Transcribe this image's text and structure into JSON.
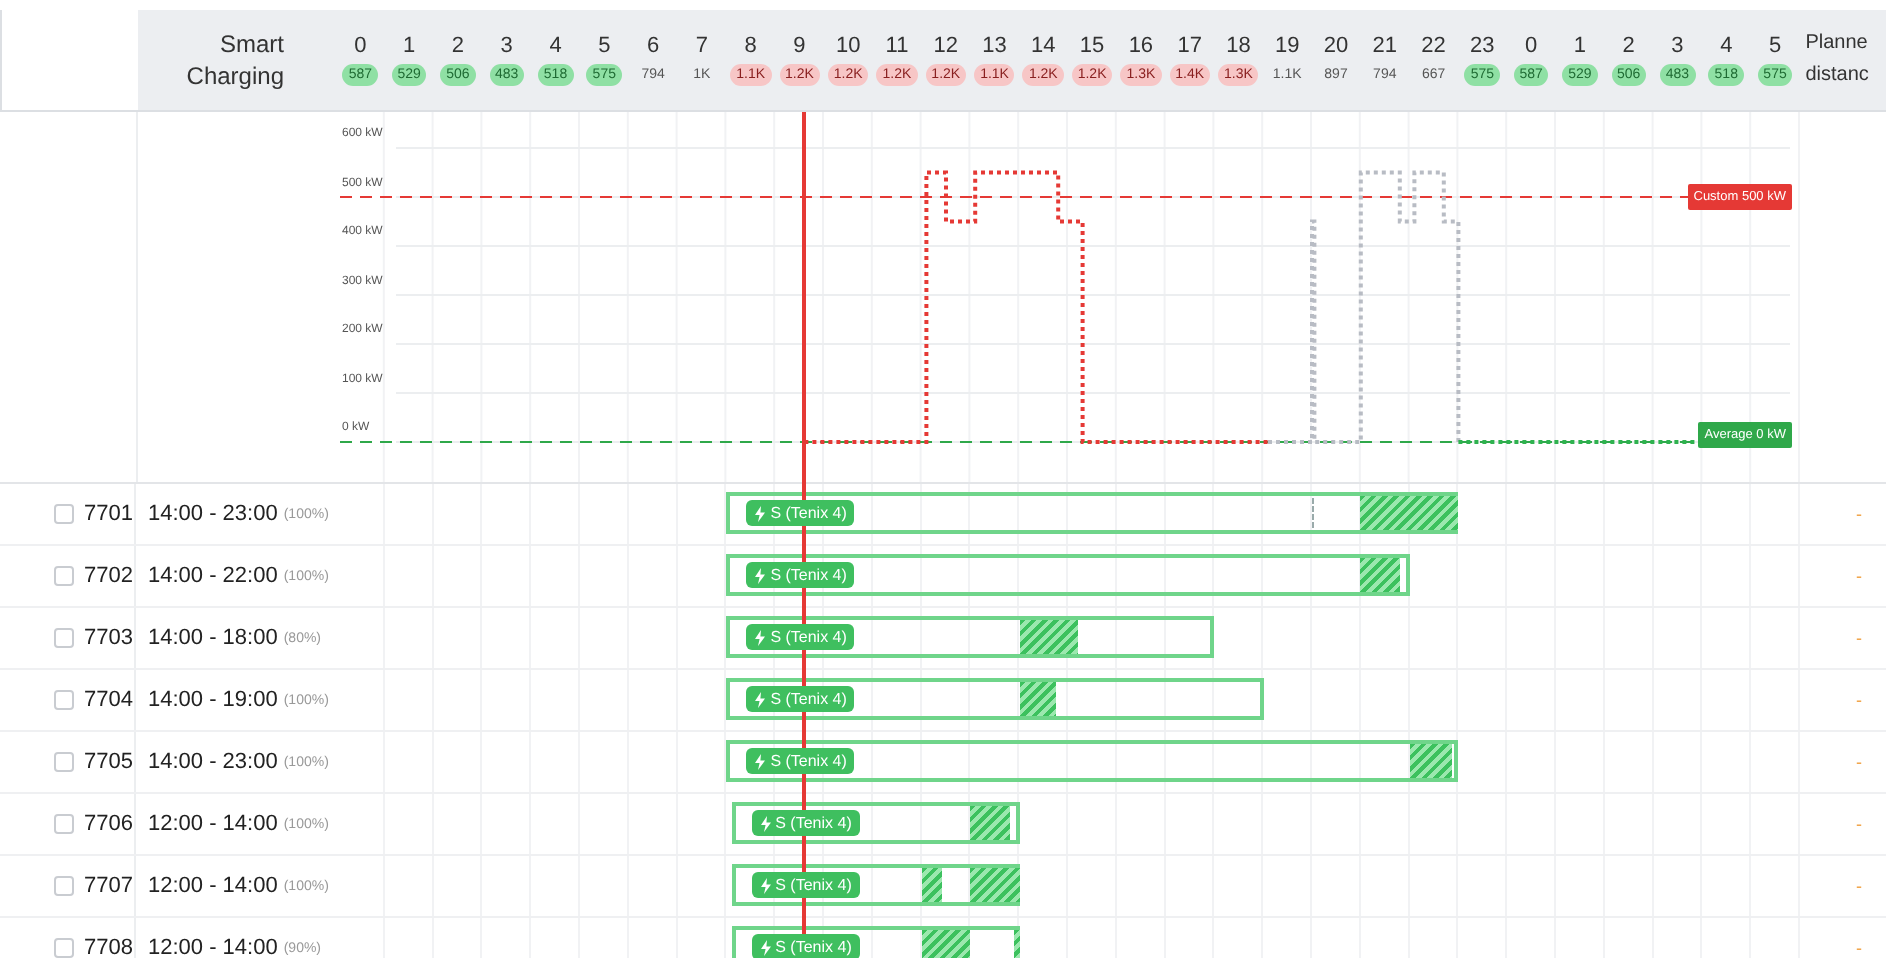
{
  "header": {
    "label_lines": [
      "Smart",
      "Charging"
    ],
    "hours": [
      {
        "hour": "0",
        "value": "587",
        "kind": "low"
      },
      {
        "hour": "1",
        "value": "529",
        "kind": "low"
      },
      {
        "hour": "2",
        "value": "506",
        "kind": "low"
      },
      {
        "hour": "3",
        "value": "483",
        "kind": "low"
      },
      {
        "hour": "4",
        "value": "518",
        "kind": "low"
      },
      {
        "hour": "5",
        "value": "575",
        "kind": "low"
      },
      {
        "hour": "6",
        "value": "794",
        "kind": "mid"
      },
      {
        "hour": "7",
        "value": "1K",
        "kind": "mid"
      },
      {
        "hour": "8",
        "value": "1.1K",
        "kind": "high"
      },
      {
        "hour": "9",
        "value": "1.2K",
        "kind": "high"
      },
      {
        "hour": "10",
        "value": "1.2K",
        "kind": "high"
      },
      {
        "hour": "11",
        "value": "1.2K",
        "kind": "high"
      },
      {
        "hour": "12",
        "value": "1.2K",
        "kind": "high"
      },
      {
        "hour": "13",
        "value": "1.1K",
        "kind": "high"
      },
      {
        "hour": "14",
        "value": "1.2K",
        "kind": "high"
      },
      {
        "hour": "15",
        "value": "1.2K",
        "kind": "high"
      },
      {
        "hour": "16",
        "value": "1.3K",
        "kind": "high"
      },
      {
        "hour": "17",
        "value": "1.4K",
        "kind": "high"
      },
      {
        "hour": "18",
        "value": "1.3K",
        "kind": "high"
      },
      {
        "hour": "19",
        "value": "1.1K",
        "kind": "mid"
      },
      {
        "hour": "20",
        "value": "897",
        "kind": "mid"
      },
      {
        "hour": "21",
        "value": "794",
        "kind": "mid"
      },
      {
        "hour": "22",
        "value": "667",
        "kind": "mid"
      },
      {
        "hour": "23",
        "value": "575",
        "kind": "low"
      },
      {
        "hour": "0",
        "value": "587",
        "kind": "low"
      },
      {
        "hour": "1",
        "value": "529",
        "kind": "low"
      },
      {
        "hour": "2",
        "value": "506",
        "kind": "low"
      },
      {
        "hour": "3",
        "value": "483",
        "kind": "low"
      },
      {
        "hour": "4",
        "value": "518",
        "kind": "low"
      },
      {
        "hour": "5",
        "value": "575",
        "kind": "low"
      }
    ],
    "extra_column_lines": [
      "Planne",
      "distanc"
    ]
  },
  "chart": {
    "y_labels": [
      "600 kW",
      "500 kW",
      "400 kW",
      "300 kW",
      "200 kW",
      "100 kW",
      "0 kW"
    ],
    "references": [
      {
        "label": "Custom 500 kW",
        "kind": "limit"
      },
      {
        "label": "Average 0 kW",
        "kind": "average"
      }
    ]
  },
  "rows": [
    {
      "id": "7701",
      "checked": false,
      "time": "14:00 - 23:00",
      "percent": "(100%)",
      "distance": "-",
      "bar_label": "S (Tenix 4)"
    },
    {
      "id": "7702",
      "checked": false,
      "time": "14:00 - 22:00",
      "percent": "(100%)",
      "distance": "-",
      "bar_label": "S (Tenix 4)"
    },
    {
      "id": "7703",
      "checked": false,
      "time": "14:00 - 18:00",
      "percent": "(80%)",
      "distance": "-",
      "bar_label": "S (Tenix 4)"
    },
    {
      "id": "7704",
      "checked": false,
      "time": "14:00 - 19:00",
      "percent": "(100%)",
      "distance": "-",
      "bar_label": "S (Tenix 4)"
    },
    {
      "id": "7705",
      "checked": false,
      "time": "14:00 - 23:00",
      "percent": "(100%)",
      "distance": "-",
      "bar_label": "S (Tenix 4)"
    },
    {
      "id": "7706",
      "checked": false,
      "time": "12:00 - 14:00",
      "percent": "(100%)",
      "distance": "-",
      "bar_label": "S (Tenix 4)"
    },
    {
      "id": "7707",
      "checked": false,
      "time": "12:00 - 14:00",
      "percent": "(100%)",
      "distance": "-",
      "bar_label": "S (Tenix 4)"
    },
    {
      "id": "7708",
      "checked": false,
      "time": "12:00 - 14:00",
      "percent": "(90%)",
      "distance": "-",
      "bar_label": "S (Tenix 4)"
    }
  ]
}
